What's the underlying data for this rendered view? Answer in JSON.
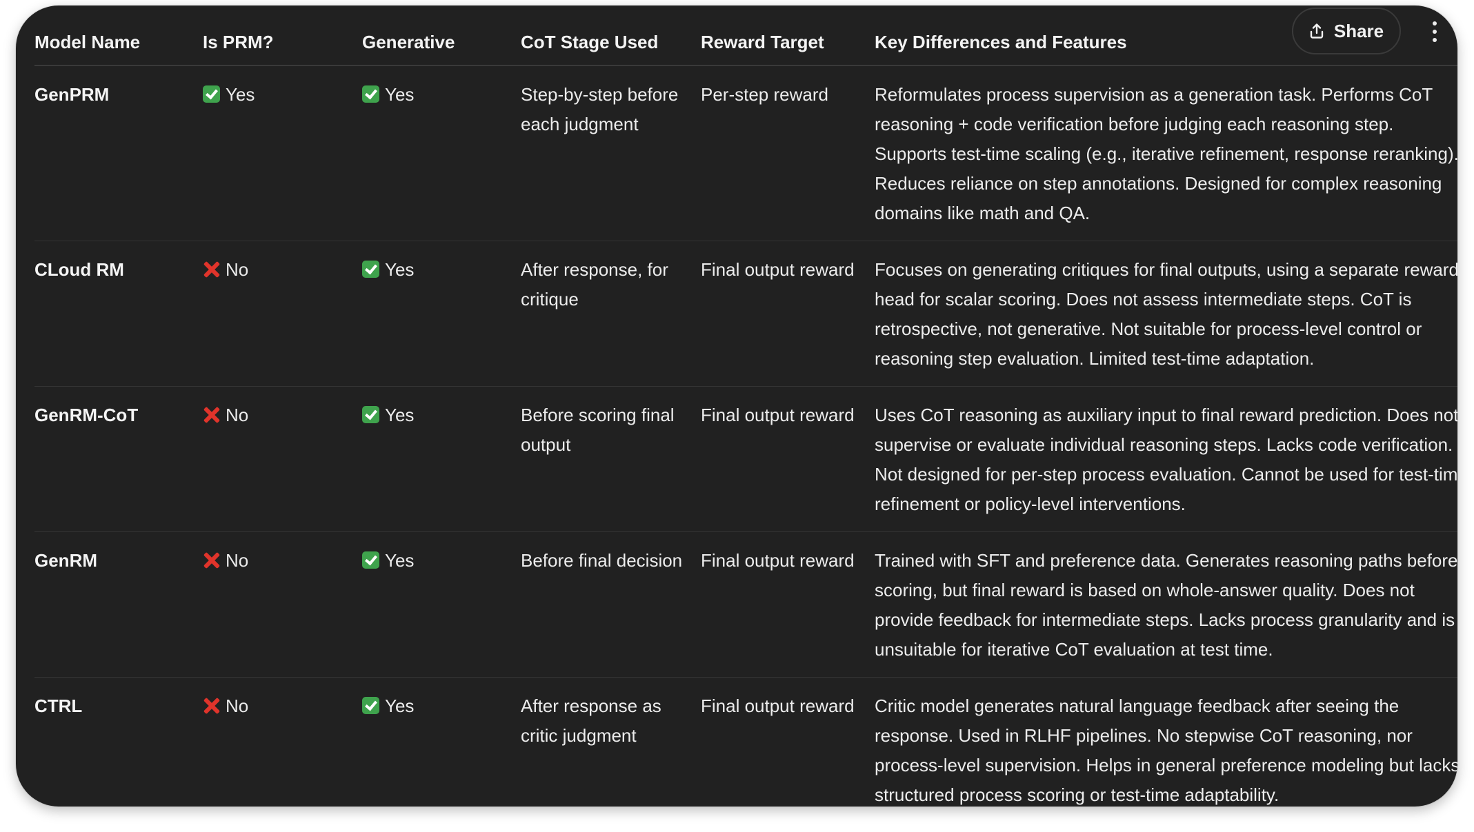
{
  "header": {
    "share_label": "Share",
    "share_icon": "share-upload-icon",
    "more_icon": "more-vertical-icon"
  },
  "table": {
    "columns": [
      "Model Name",
      "Is PRM?",
      "Generative",
      "CoT Stage Used",
      "Reward Target",
      "Key Differences and Features"
    ],
    "rows": [
      {
        "model": "GenPRM",
        "is_prm": "Yes",
        "is_prm_icon": "check-mark-icon",
        "generative": "Yes",
        "generative_icon": "check-mark-icon",
        "cot_stage": "Step-by-step before each judgment",
        "reward_target": "Per-step reward",
        "features": "Reformulates process supervision as a generation task. Performs CoT reasoning + code verification before judging each reasoning step. Supports test-time scaling (e.g., iterative refinement, response reranking). Reduces reliance on step annotations. Designed for complex reasoning domains like math and QA."
      },
      {
        "model": "CLoud RM",
        "is_prm": "No",
        "is_prm_icon": "cross-mark-icon",
        "generative": "Yes",
        "generative_icon": "check-mark-icon",
        "cot_stage": "After response, for critique",
        "reward_target": "Final output reward",
        "features": "Focuses on generating critiques for final outputs, using a separate reward head for scalar scoring. Does not assess intermediate steps. CoT is retrospective, not generative. Not suitable for process-level control or reasoning step evaluation. Limited test-time adaptation."
      },
      {
        "model": "GenRM-CoT",
        "is_prm": "No",
        "is_prm_icon": "cross-mark-icon",
        "generative": "Yes",
        "generative_icon": "check-mark-icon",
        "cot_stage": "Before scoring final output",
        "reward_target": "Final output reward",
        "features": "Uses CoT reasoning as auxiliary input to final reward prediction. Does not supervise or evaluate individual reasoning steps. Lacks code verification. Not designed for per-step process evaluation. Cannot be used for test-time refinement or policy-level interventions."
      },
      {
        "model": "GenRM",
        "is_prm": "No",
        "is_prm_icon": "cross-mark-icon",
        "generative": "Yes",
        "generative_icon": "check-mark-icon",
        "cot_stage": "Before final decision",
        "reward_target": "Final output reward",
        "features": "Trained with SFT and preference data. Generates reasoning paths before scoring, but final reward is based on whole-answer quality. Does not provide feedback for intermediate steps. Lacks process granularity and is unsuitable for iterative CoT evaluation at test time."
      },
      {
        "model": "CTRL",
        "is_prm": "No",
        "is_prm_icon": "cross-mark-icon",
        "generative": "Yes",
        "generative_icon": "check-mark-icon",
        "cot_stage": "After response as critic judgment",
        "reward_target": "Final output reward",
        "features": "Critic model generates natural language feedback after seeing the response. Used in RLHF pipelines. No stepwise CoT reasoning, nor process-level supervision. Helps in general preference modeling but lacks structured process scoring or test-time adaptability."
      }
    ]
  }
}
